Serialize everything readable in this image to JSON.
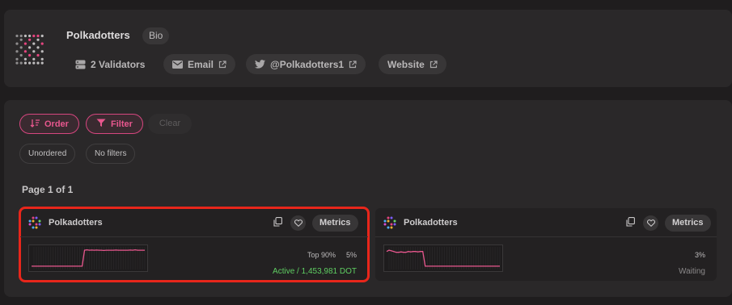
{
  "entity": {
    "name": "Polkadotters",
    "bio_label": "Bio",
    "validators_label": "2 Validators",
    "email_label": "Email",
    "twitter_label": "@Polkadotters1",
    "website_label": "Website"
  },
  "controls": {
    "order_label": "Order",
    "filter_label": "Filter",
    "clear_label": "Clear",
    "order_state": "Unordered",
    "filter_state": "No filters"
  },
  "pagination": {
    "label": "Page 1 of 1"
  },
  "validators": [
    {
      "name": "Polkadotters",
      "metrics_label": "Metrics",
      "rank": "Top 90%",
      "commission": "5%",
      "status": "Active / 1,453,981 DOT",
      "status_color": "#5fcf62",
      "sparkline": [
        0.12,
        0.12,
        0.12,
        0.12,
        0.12,
        0.12,
        0.12,
        0.12,
        0.12,
        0.12,
        0.12,
        0.12,
        0.12,
        0.12,
        0.12,
        0.12,
        0.12,
        0.12,
        0.12,
        0.12,
        0.12,
        0.12,
        0.88,
        0.9,
        0.88,
        0.89,
        0.88,
        0.89,
        0.88,
        0.88,
        0.87,
        0.88,
        0.88,
        0.88,
        0.88,
        0.89,
        0.88,
        0.88,
        0.88,
        0.88,
        0.88,
        0.89,
        0.88,
        0.9,
        0.88,
        0.88,
        0.88,
        0.88
      ]
    },
    {
      "name": "Polkadotters",
      "metrics_label": "Metrics",
      "rank": "",
      "commission": "3%",
      "status": "Waiting",
      "status_color": "#8a8889",
      "sparkline": [
        0.82,
        0.88,
        0.85,
        0.82,
        0.78,
        0.78,
        0.8,
        0.78,
        0.78,
        0.82,
        0.8,
        0.82,
        0.82,
        0.8,
        0.82,
        0.82,
        0.12,
        0.12,
        0.12,
        0.12,
        0.12,
        0.12,
        0.12,
        0.12,
        0.12,
        0.12,
        0.12,
        0.12,
        0.12,
        0.12,
        0.12,
        0.12,
        0.12,
        0.12,
        0.12,
        0.12,
        0.12,
        0.12,
        0.12,
        0.12,
        0.12,
        0.12,
        0.12,
        0.12,
        0.12,
        0.12,
        0.12,
        0.12
      ]
    }
  ],
  "colors": {
    "accent": "#e8578e",
    "sparkline": "#e8578e",
    "highlight": "#e8261b"
  }
}
